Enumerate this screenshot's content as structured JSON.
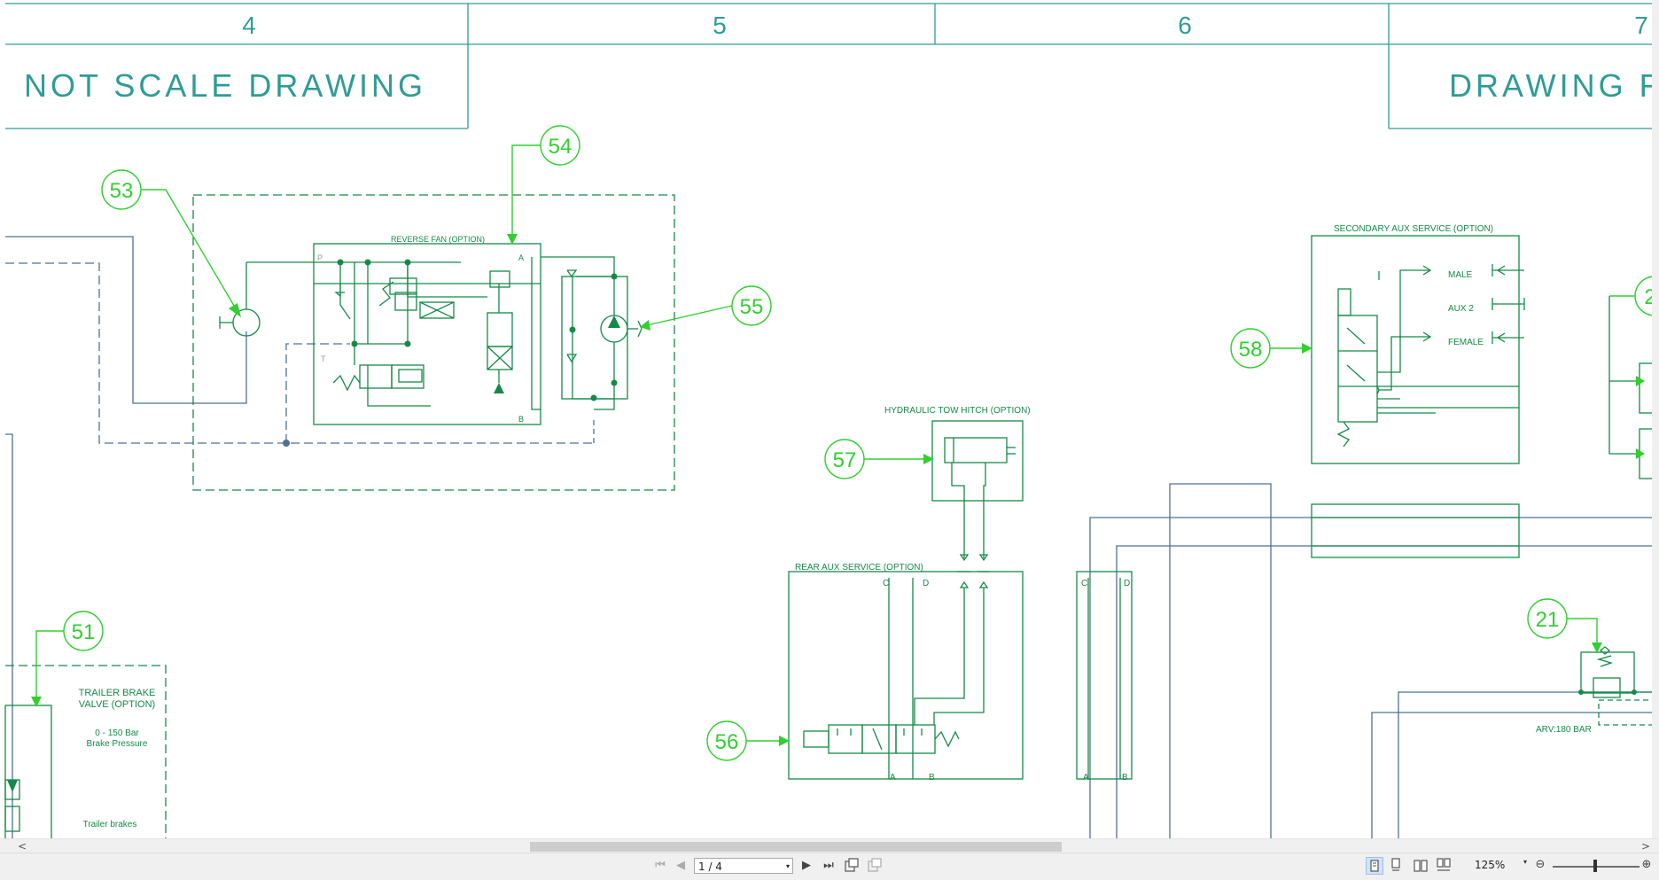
{
  "colors": {
    "frame": "#2f9c96",
    "circuit": "#148a48",
    "callout": "#31cf31",
    "pipe": "#4e7098"
  },
  "title_block": {
    "columns": [
      "4",
      "5",
      "6",
      "7"
    ],
    "left_text": "NOT SCALE DRAWING",
    "right_text": "DRAWING R"
  },
  "callouts": [
    "53",
    "54",
    "55",
    "51",
    "57",
    "56",
    "58",
    "21",
    "2"
  ],
  "labels": {
    "reverse_fan": "REVERSE   FAN (OPTION)",
    "port_p": "P",
    "port_a": "A",
    "port_t": "T",
    "port_b": "B",
    "tow_hitch": "HYDRAULIC TOW HITCH (OPTION)",
    "rear_aux": "REAR AUX SERVICE (OPTION)",
    "rear_c": "C",
    "rear_d": "D",
    "rear_a": "A",
    "rear_b": "B",
    "side_c": "C",
    "side_d": "D",
    "side_a": "A",
    "side_b": "B",
    "secondary_aux": "SECONDARY AUX SERVICE (OPTION)",
    "male": "MALE",
    "aux2": "AUX 2",
    "female": "FEMALE",
    "trailer_brake_1": "TRAILER BRAKE",
    "trailer_brake_2": "VALVE (OPTION)",
    "brake_pressure_1": "0  -  150   Bar",
    "brake_pressure_2": "Brake Pressure",
    "trailer_brakes": "Trailer brakes",
    "arv": "ARV:180 BAR"
  },
  "viewer": {
    "page_indicator": "1 / 4",
    "zoom_level": "125%",
    "nav_first": "⏮",
    "nav_prev": "◀",
    "nav_next": "▶",
    "nav_last": "⏭",
    "scroll_left": "<",
    "scroll_right": ">",
    "zoom_out": "⊖",
    "zoom_in": "⊕",
    "dropdown_arrow": "▾"
  }
}
